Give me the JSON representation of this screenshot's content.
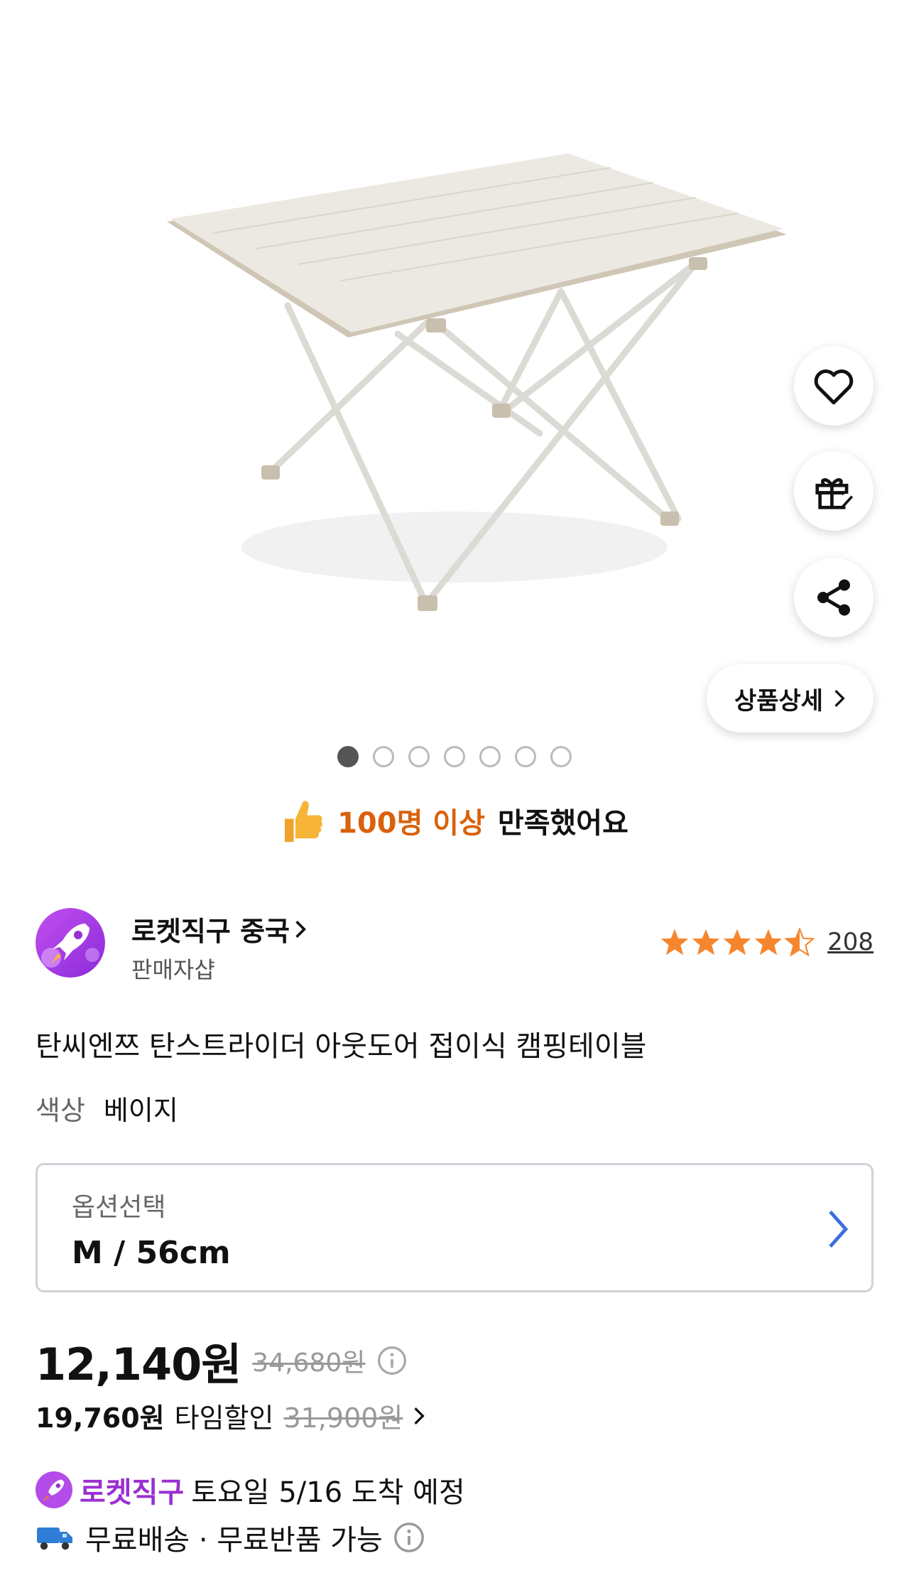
{
  "gallery": {
    "image_alt": "folding camping table",
    "total_images": 7,
    "active_index": 0
  },
  "actions": {
    "like_icon": "heart-icon",
    "gift_icon": "gift-icon",
    "share_icon": "share-icon",
    "detail_label": "상품상세"
  },
  "satisfaction": {
    "highlight": "100명 이상",
    "text": "만족했어요"
  },
  "seller": {
    "name": "로켓직구 중국",
    "subtitle": "판매자샵",
    "rating": 4.5,
    "review_count": "208"
  },
  "product": {
    "title": "탄씨엔쯔 탄스트라이더 아웃도어 접이식 캠핑테이블",
    "color_label": "색상",
    "color_value": "베이지"
  },
  "option": {
    "label": "옵션선택",
    "value": "M / 56cm"
  },
  "price": {
    "sale": "12,140원",
    "original": "34,680원",
    "time_price": "19,760원",
    "time_label": "타임할인",
    "time_original": "31,900원"
  },
  "delivery": {
    "brand": "로켓직구",
    "info": "토요일 5/16 도착 예정",
    "shipping": "무료배송 · 무료반품 가능"
  },
  "colors": {
    "accent_orange": "#d9610b",
    "rocket_purple": "#9a2fd1",
    "star_orange": "#f5862e",
    "chevron_blue": "#3b6fe0"
  }
}
